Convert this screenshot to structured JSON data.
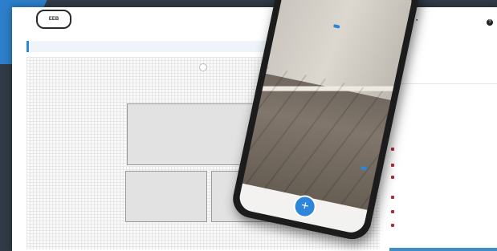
{
  "app": {
    "logo_text": "EEB",
    "logo_caption": "",
    "breadcrumb": "",
    "user_label": "",
    "help_label": "?"
  },
  "floorplan": {
    "rooms": [
      {
        "name": "",
        "area": ""
      },
      {
        "name": "",
        "area": ""
      },
      {
        "name": "",
        "area": ""
      }
    ]
  },
  "side_panel": {
    "title": "",
    "subtitle": "",
    "rows": [
      "",
      "",
      "",
      "",
      "",
      "",
      "",
      "",
      "",
      ""
    ],
    "footer_button": ""
  },
  "phone": {
    "measure_1": "",
    "measure_2": "",
    "cancel_label": "",
    "add_label": "+"
  },
  "colors": {
    "accent": "#2d86d9",
    "marker": "#b22a3a"
  }
}
